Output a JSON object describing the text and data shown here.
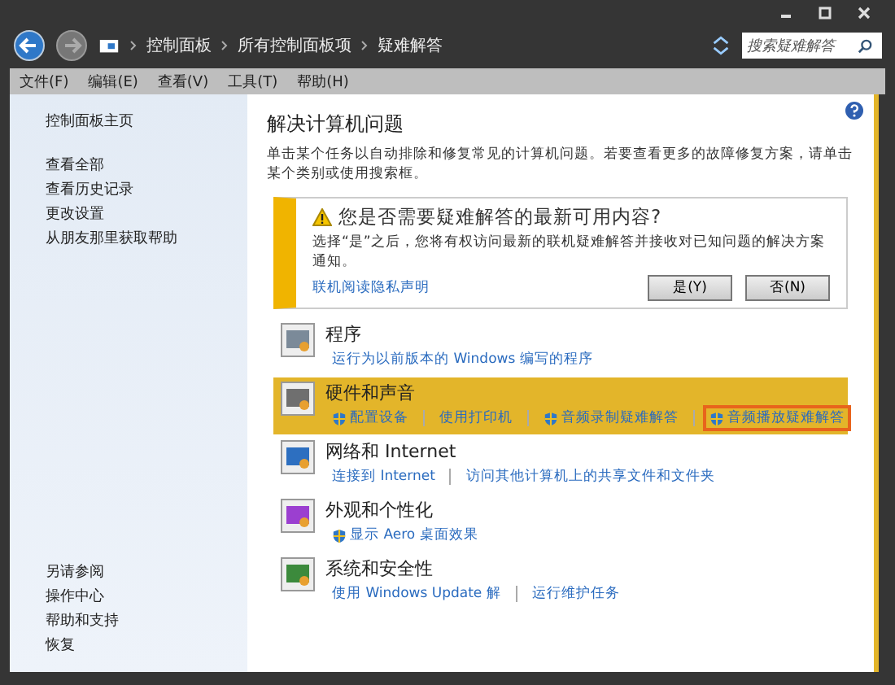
{
  "address_bar": {
    "crumbs": [
      "控制面板",
      "所有控制面板项",
      "疑难解答"
    ]
  },
  "search": {
    "placeholder": "搜索疑难解答"
  },
  "menu": [
    "文件(F)",
    "编辑(E)",
    "查看(V)",
    "工具(T)",
    "帮助(H)"
  ],
  "sidebar": {
    "home": "控制面板主页",
    "links": [
      "查看全部",
      "查看历史记录",
      "更改设置",
      "从朋友那里获取帮助"
    ],
    "see_also_title": "另请参阅",
    "see_also": [
      "操作中心",
      "帮助和支持",
      "恢复"
    ]
  },
  "main": {
    "title": "解决计算机问题",
    "description": "单击某个任务以自动排除和修复常见的计算机问题。若要查看更多的故障修复方案，请单击某个类别或使用搜索框。"
  },
  "notice": {
    "title": "您是否需要疑难解答的最新可用内容?",
    "text": "选择“是”之后，您将有权访问最新的联机疑难解答并接收对已知问题的解决方案通知。",
    "link": "联机阅读隐私声明",
    "buttons": [
      "是(Y)",
      "否(N)"
    ]
  },
  "categories": [
    {
      "title": "程序",
      "selected": false,
      "links": [
        {
          "text": "运行为以前版本的 Windows 编写的程序",
          "shield": false,
          "selected": false
        }
      ]
    },
    {
      "title": "硬件和声音",
      "selected": true,
      "links": [
        {
          "text": "配置设备",
          "shield": true,
          "selected": false
        },
        {
          "text": "使用打印机",
          "shield": false,
          "selected": false
        },
        {
          "text": "音频录制疑难解答",
          "shield": true,
          "selected": false
        },
        {
          "text": "音频播放疑难解答",
          "shield": true,
          "selected": true
        }
      ]
    },
    {
      "title": "网络和 Internet",
      "selected": false,
      "links": [
        {
          "text": "连接到 Internet",
          "shield": false,
          "selected": false
        },
        {
          "text": "访问其他计算机上的共享文件和文件夹",
          "shield": false,
          "selected": false
        }
      ]
    },
    {
      "title": "外观和个性化",
      "selected": false,
      "links": [
        {
          "text": "显示 Aero 桌面效果",
          "shield": true,
          "selected": false
        }
      ]
    },
    {
      "title": "系统和安全性",
      "selected": false,
      "links": [
        {
          "text": "使用 Windows Update 解",
          "shield": false,
          "selected": false
        },
        {
          "text": "运行维护任务",
          "shield": false,
          "selected": false
        }
      ]
    }
  ]
}
